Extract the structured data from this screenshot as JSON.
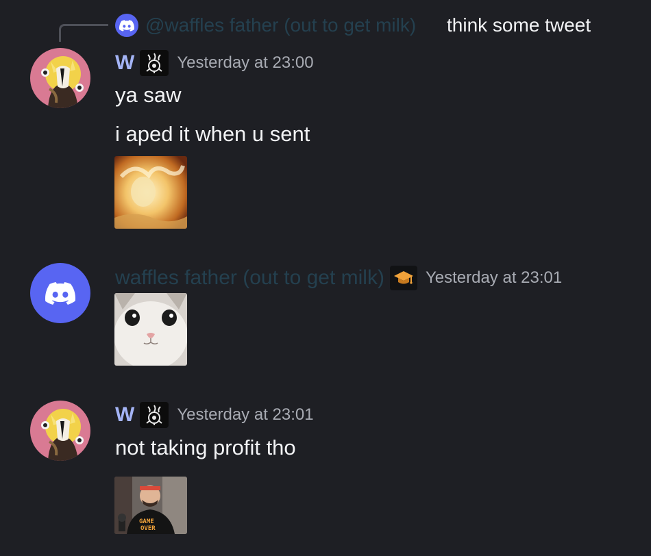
{
  "reply": {
    "mention": "@waffles father (out to get milk)",
    "text": "think some tweet"
  },
  "messages": [
    {
      "author": "W",
      "timestamp": "Yesterday at 23:00",
      "lines": [
        "ya saw",
        "i aped it when u sent"
      ],
      "attachment": "fire-meme-image",
      "avatar": "anime-character-avatar",
      "badge": "occult-emblem-icon"
    },
    {
      "author": "waffles father (out to get milk)",
      "timestamp": "Yesterday at 23:01",
      "lines": [],
      "attachment": "kitten-face-image",
      "avatar": "discord-logo-icon",
      "badge": "graduation-cap-icon"
    },
    {
      "author": "W",
      "timestamp": "Yesterday at 23:01",
      "lines": [
        "not taking profit tho"
      ],
      "attachment": "streamer-game-over-shirt-image",
      "avatar": "anime-character-avatar",
      "badge": "occult-emblem-icon"
    }
  ],
  "colors": {
    "background": "#1e1f24",
    "username_w": "#a4b4f6",
    "username_waffles": "#24404f",
    "timestamp": "#a8abb3",
    "discord_blurple": "#5865f2"
  }
}
